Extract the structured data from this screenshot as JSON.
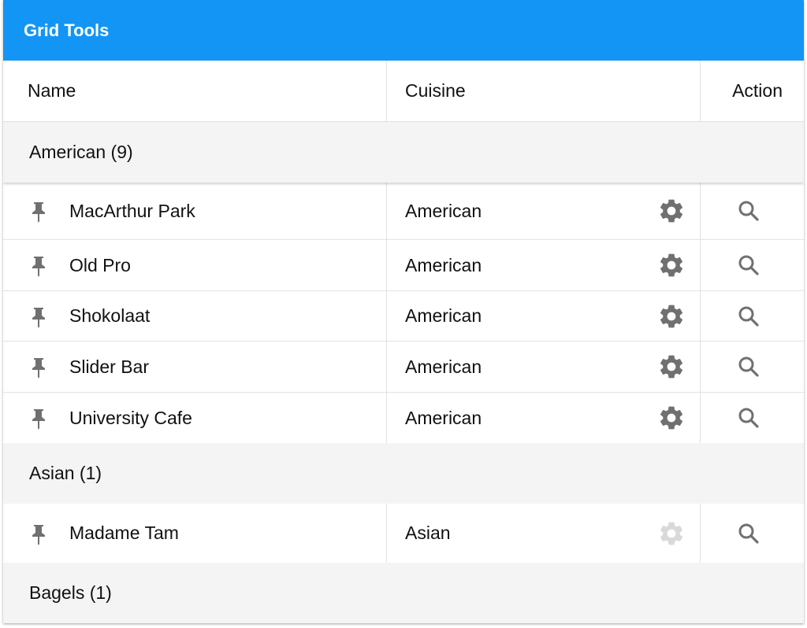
{
  "toolbar": {
    "title": "Grid Tools"
  },
  "columns": {
    "name": "Name",
    "cuisine": "Cuisine",
    "action": "Action"
  },
  "groups": [
    {
      "label": "American (9)",
      "rows": [
        {
          "name": "MacArthur Park",
          "cuisine": "American",
          "gear_enabled": true
        },
        {
          "name": "Old Pro",
          "cuisine": "American",
          "gear_enabled": true
        },
        {
          "name": "Shokolaat",
          "cuisine": "American",
          "gear_enabled": true
        },
        {
          "name": "Slider Bar",
          "cuisine": "American",
          "gear_enabled": true
        },
        {
          "name": "University Cafe",
          "cuisine": "American",
          "gear_enabled": true
        }
      ]
    },
    {
      "label": "Asian (1)",
      "rows": [
        {
          "name": "Madame Tam",
          "cuisine": "Asian",
          "gear_enabled": false
        }
      ]
    },
    {
      "label": "Bagels (1)",
      "rows": []
    }
  ],
  "icons": {
    "pin": "pin-icon",
    "gear": "gear-icon",
    "search": "search-icon"
  },
  "colors": {
    "toolbar_bg": "#1395f5",
    "group_bg": "#f4f4f4",
    "icon_gray": "#707070",
    "icon_disabled": "#d9d9d9"
  }
}
